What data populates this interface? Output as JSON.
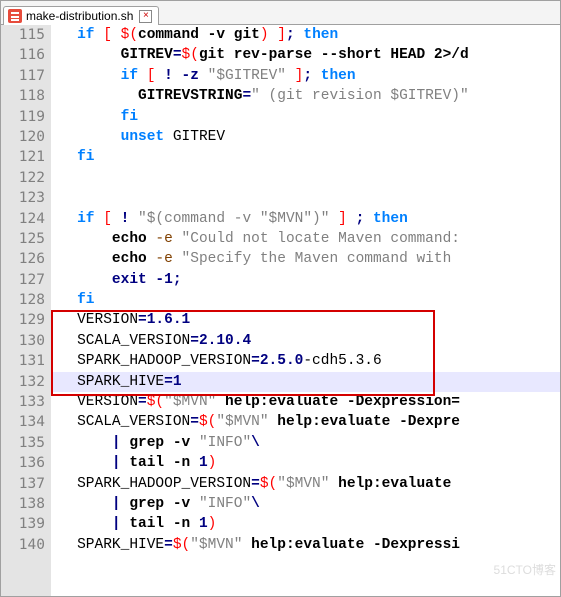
{
  "tab": {
    "filename": "make-distribution.sh",
    "close": "×"
  },
  "gutter_start": 115,
  "lines": [
    {
      "n": 115,
      "spans": [
        [
          "   ",
          ""
        ],
        [
          "if",
          " kw"
        ],
        [
          " [ ",
          "br"
        ],
        [
          "$(",
          "br"
        ],
        [
          "command -v git",
          "id"
        ],
        [
          ")",
          "br"
        ],
        [
          " ]",
          "br"
        ],
        [
          "; ",
          "op"
        ],
        [
          "then",
          "kw"
        ]
      ]
    },
    {
      "n": 116,
      "spans": [
        [
          "        ",
          ""
        ],
        [
          "GITREV",
          "id"
        ],
        [
          "=",
          "op"
        ],
        [
          "$(",
          "br"
        ],
        [
          "git rev-parse --short HEAD 2>/d",
          "id"
        ]
      ]
    },
    {
      "n": 117,
      "spans": [
        [
          "        ",
          ""
        ],
        [
          "if",
          " kw"
        ],
        [
          " [ ",
          "br"
        ],
        [
          "! -z",
          "op"
        ],
        [
          " \"$GITREV\" ",
          "st"
        ],
        [
          "]",
          "br"
        ],
        [
          "; ",
          "op"
        ],
        [
          "then",
          "kw"
        ]
      ]
    },
    {
      "n": 118,
      "spans": [
        [
          "          ",
          ""
        ],
        [
          "GITREVSTRING",
          "id"
        ],
        [
          "=",
          "op"
        ],
        [
          "\" (git revision $GITREV)\"",
          "st"
        ]
      ]
    },
    {
      "n": 119,
      "spans": [
        [
          "        ",
          ""
        ],
        [
          "fi",
          "kw"
        ]
      ]
    },
    {
      "n": 120,
      "spans": [
        [
          "        ",
          ""
        ],
        [
          "unset",
          "kw"
        ],
        [
          " GITREV",
          "fn"
        ]
      ]
    },
    {
      "n": 121,
      "spans": [
        [
          "   ",
          ""
        ],
        [
          "fi",
          "kw"
        ]
      ]
    },
    {
      "n": 122,
      "spans": [
        [
          "",
          ""
        ]
      ]
    },
    {
      "n": 123,
      "spans": [
        [
          "",
          ""
        ]
      ]
    },
    {
      "n": 124,
      "spans": [
        [
          "   ",
          ""
        ],
        [
          "if",
          "kw"
        ],
        [
          " [ ",
          "br"
        ],
        [
          "! ",
          "op"
        ],
        [
          "\"$(command -v \"$MVN\")\"",
          "st"
        ],
        [
          " ]",
          "br"
        ],
        [
          " ; ",
          "op"
        ],
        [
          "then",
          "kw"
        ]
      ]
    },
    {
      "n": 125,
      "spans": [
        [
          "       ",
          ""
        ],
        [
          "echo",
          "id"
        ],
        [
          " -e ",
          "macro"
        ],
        [
          "\"Could not locate Maven command: ",
          "st"
        ]
      ]
    },
    {
      "n": 126,
      "spans": [
        [
          "       ",
          ""
        ],
        [
          "echo",
          "id"
        ],
        [
          " -e ",
          "macro"
        ],
        [
          "\"Specify the Maven command with ",
          "st"
        ]
      ]
    },
    {
      "n": 127,
      "spans": [
        [
          "       ",
          ""
        ],
        [
          "exit",
          "op"
        ],
        [
          " -1",
          "op"
        ],
        [
          ";",
          "op"
        ]
      ]
    },
    {
      "n": 128,
      "spans": [
        [
          "   ",
          ""
        ],
        [
          "fi",
          "kw"
        ]
      ]
    },
    {
      "n": 129,
      "spans": [
        [
          "   ",
          ""
        ],
        [
          "VERSION",
          "fn"
        ],
        [
          "=",
          "op"
        ],
        [
          "1.6.1",
          "op"
        ]
      ]
    },
    {
      "n": 130,
      "spans": [
        [
          "   ",
          ""
        ],
        [
          "SCALA_VERSION",
          "fn"
        ],
        [
          "=",
          "op"
        ],
        [
          "2.10.4",
          "op"
        ]
      ]
    },
    {
      "n": 131,
      "spans": [
        [
          "   ",
          ""
        ],
        [
          "SPARK_HADOOP_VERSION",
          "fn"
        ],
        [
          "=",
          "op"
        ],
        [
          "2.5.0",
          "op"
        ],
        [
          "-cdh5.3.6",
          "fn"
        ]
      ]
    },
    {
      "n": 132,
      "cls": "hlL",
      "spans": [
        [
          "   ",
          ""
        ],
        [
          "SPARK_HIVE",
          "fn"
        ],
        [
          "=",
          "op"
        ],
        [
          "1",
          "op"
        ]
      ]
    },
    {
      "n": 133,
      "spans": [
        [
          "   ",
          ""
        ],
        [
          "VERSION",
          "fn"
        ],
        [
          "=",
          "op"
        ],
        [
          "$(",
          "br"
        ],
        [
          "\"$MVN\"",
          "st"
        ],
        [
          " help:evaluate -Dexpression=",
          "id"
        ]
      ]
    },
    {
      "n": 134,
      "spans": [
        [
          "   ",
          ""
        ],
        [
          "SCALA_VERSION",
          "fn"
        ],
        [
          "=",
          "op"
        ],
        [
          "$(",
          "br"
        ],
        [
          "\"$MVN\"",
          "st"
        ],
        [
          " help:evaluate -Dexpre",
          "id"
        ]
      ]
    },
    {
      "n": 135,
      "spans": [
        [
          "       | ",
          "op"
        ],
        [
          "grep -v ",
          "id"
        ],
        [
          "\"INFO\"",
          "st"
        ],
        [
          "\\",
          "op"
        ]
      ]
    },
    {
      "n": 136,
      "spans": [
        [
          "       | ",
          "op"
        ],
        [
          "tail -n ",
          "id"
        ],
        [
          "1",
          "op"
        ],
        [
          ")",
          "br"
        ]
      ]
    },
    {
      "n": 137,
      "spans": [
        [
          "   ",
          ""
        ],
        [
          "SPARK_HADOOP_VERSION",
          "fn"
        ],
        [
          "=",
          "op"
        ],
        [
          "$(",
          "br"
        ],
        [
          "\"$MVN\"",
          "st"
        ],
        [
          " help:evaluate ",
          "id"
        ]
      ]
    },
    {
      "n": 138,
      "spans": [
        [
          "       | ",
          "op"
        ],
        [
          "grep -v ",
          "id"
        ],
        [
          "\"INFO\"",
          "st"
        ],
        [
          "\\",
          "op"
        ]
      ]
    },
    {
      "n": 139,
      "spans": [
        [
          "       | ",
          "op"
        ],
        [
          "tail -n ",
          "id"
        ],
        [
          "1",
          "op"
        ],
        [
          ")",
          "br"
        ]
      ]
    },
    {
      "n": 140,
      "spans": [
        [
          "   ",
          ""
        ],
        [
          "SPARK_HIVE",
          "fn"
        ],
        [
          "=",
          "op"
        ],
        [
          "$(",
          "br"
        ],
        [
          "\"$MVN\"",
          "st"
        ],
        [
          " help:evaluate -Dexpressi",
          "id"
        ]
      ]
    }
  ],
  "watermark": "51CTO博客"
}
